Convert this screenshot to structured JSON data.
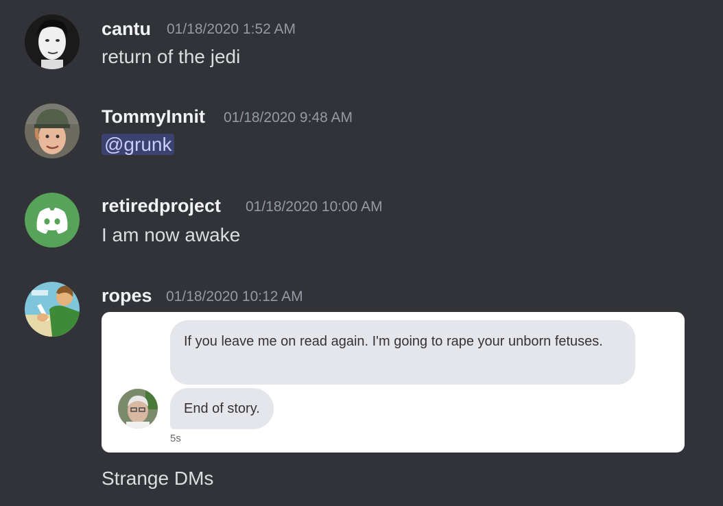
{
  "messages": [
    {
      "username": "cantu",
      "timestamp": "01/18/2020 1:52 AM",
      "text": "return of the jedi",
      "avatar": "portrait-bw"
    },
    {
      "username": "TommyInnit",
      "timestamp": "01/18/2020 9:48 AM",
      "mention": "@grunk",
      "avatar": "portrait-cap"
    },
    {
      "username": "retiredproject",
      "timestamp": "01/18/2020 10:00 AM",
      "text": "I am now awake",
      "avatar": "discord-logo",
      "avatar_color": "#57a35a"
    },
    {
      "username": "ropes",
      "timestamp": "01/18/2020 10:12 AM",
      "avatar": "cartoon-portrait",
      "embed": {
        "bubble1": "If you leave me on read again. I'm going to rape your unborn fetuses.",
        "bubble2": "End of story.",
        "time": "5s"
      },
      "caption": "Strange DMs"
    }
  ],
  "colors": {
    "background": "#313338",
    "mention_bg": "#3c4270",
    "mention_text": "#c9cdfb",
    "timestamp": "#949ba4"
  }
}
